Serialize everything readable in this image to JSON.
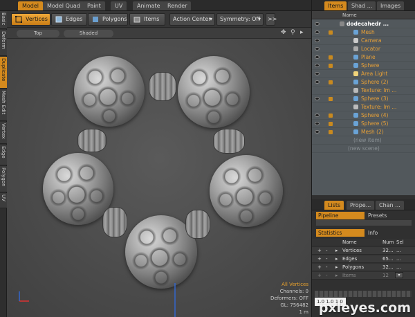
{
  "mode_tabs": [
    "Model",
    "Model Quad",
    "Paint",
    "UV",
    "Animate",
    "Render"
  ],
  "active_mode": "Model",
  "toolbar": {
    "vertices": "Vertices",
    "edges": "Edges",
    "polygons": "Polygons",
    "items": "Items",
    "action_center": "Action Center",
    "symmetry": "Symmetry: Off",
    "more": ">>"
  },
  "left_tabs": [
    "Basic",
    "Deform",
    "Duplicate",
    "Mesh Edit",
    "Vertex",
    "Edge",
    "Polygon",
    "UV"
  ],
  "active_left_tab": "Duplicate",
  "viewport": {
    "view": "Top",
    "shading": "Shaded",
    "info": {
      "selection": "All Vertices",
      "channels": "Channels: 0",
      "deformers": "Deformers: OFF",
      "gl": "GL: 756482",
      "scale": "1 m"
    }
  },
  "right_tabs": [
    "Items",
    "Shad ...",
    "Images"
  ],
  "item_list": {
    "col_name": "Name",
    "items": [
      {
        "label": "dodecahedr ...",
        "type": "group",
        "indent": 0
      },
      {
        "label": "Mesh",
        "type": "mesh",
        "indent": 1
      },
      {
        "label": "Camera",
        "type": "camera",
        "indent": 1
      },
      {
        "label": "Locator",
        "type": "locator",
        "indent": 1
      },
      {
        "label": "Plane",
        "type": "mesh",
        "indent": 1
      },
      {
        "label": "Sphere",
        "type": "mesh",
        "indent": 1
      },
      {
        "label": "Area Light",
        "type": "light",
        "indent": 1
      },
      {
        "label": "Sphere (2)",
        "type": "mesh",
        "indent": 1
      },
      {
        "label": "Texture: Im ...",
        "type": "texture",
        "indent": 1
      },
      {
        "label": "Sphere (3)",
        "type": "mesh",
        "indent": 1
      },
      {
        "label": "Texture: Im ...",
        "type": "texture",
        "indent": 1
      },
      {
        "label": "Sphere (4)",
        "type": "mesh",
        "indent": 1
      },
      {
        "label": "Sphere (5)",
        "type": "mesh",
        "indent": 1
      },
      {
        "label": "Mesh (2)",
        "type": "mesh",
        "indent": 1
      }
    ],
    "new_item": "(new item)",
    "new_scene": "(new scene)"
  },
  "bottom_tabs": [
    "Lists",
    "Prope...",
    "Chan ..."
  ],
  "pipeline_tabs": [
    "Pipeline",
    "Presets"
  ],
  "stat_tabs": [
    "Statistics",
    "Info"
  ],
  "stats": {
    "headers": [
      "Name",
      "Num",
      "Sel"
    ],
    "rows": [
      {
        "name": "Vertices",
        "num": "32...",
        "sel": "..."
      },
      {
        "name": "Edges",
        "num": "65...",
        "sel": "..."
      },
      {
        "name": "Polygons",
        "num": "32...",
        "sel": "..."
      },
      {
        "name": "Items",
        "num": "12",
        "sel": "..."
      }
    ]
  },
  "swatch": "1.0 1.0 1.0",
  "watermark": "pxleyes.com"
}
